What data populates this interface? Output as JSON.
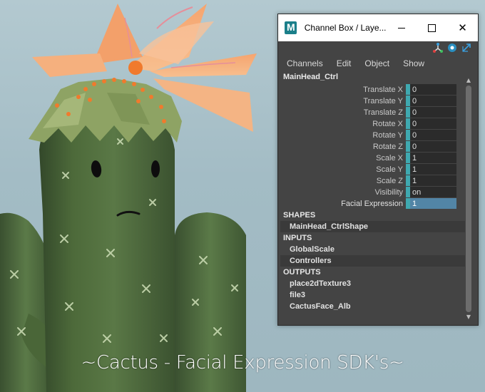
{
  "caption": "~Cactus - Facial Expression SDK's~",
  "window": {
    "title": "Channel Box / Laye...",
    "controls": {
      "minimize": "",
      "maximize": "",
      "close": "✕"
    }
  },
  "menu": [
    "Channels",
    "Edit",
    "Object",
    "Show"
  ],
  "node": "MainHead_Ctrl",
  "attributes": [
    {
      "name": "Translate X",
      "value": "0"
    },
    {
      "name": "Translate Y",
      "value": "0"
    },
    {
      "name": "Translate Z",
      "value": "0"
    },
    {
      "name": "Rotate X",
      "value": "0"
    },
    {
      "name": "Rotate Y",
      "value": "0"
    },
    {
      "name": "Rotate Z",
      "value": "0"
    },
    {
      "name": "Scale X",
      "value": "1"
    },
    {
      "name": "Scale Y",
      "value": "1"
    },
    {
      "name": "Scale Z",
      "value": "1"
    },
    {
      "name": "Visibility",
      "value": "on"
    },
    {
      "name": "Facial Expression",
      "value": "1"
    }
  ],
  "sections": {
    "shapes": {
      "label": "SHAPES",
      "items": [
        "MainHead_CtrlShape"
      ]
    },
    "inputs": {
      "label": "INPUTS",
      "items": [
        "GlobalScale",
        "Controllers"
      ]
    },
    "outputs": {
      "label": "OUTPUTS",
      "items": [
        "place2dTexture3",
        "file3",
        "CactusFace_Alb"
      ]
    }
  },
  "colors": {
    "panel": "#444444",
    "channel_marker": "#3fa9b0",
    "selected_value": "#5285a6"
  },
  "icons": [
    "maya-logo-icon",
    "axis-icon",
    "sphere-icon",
    "expand-icon"
  ]
}
